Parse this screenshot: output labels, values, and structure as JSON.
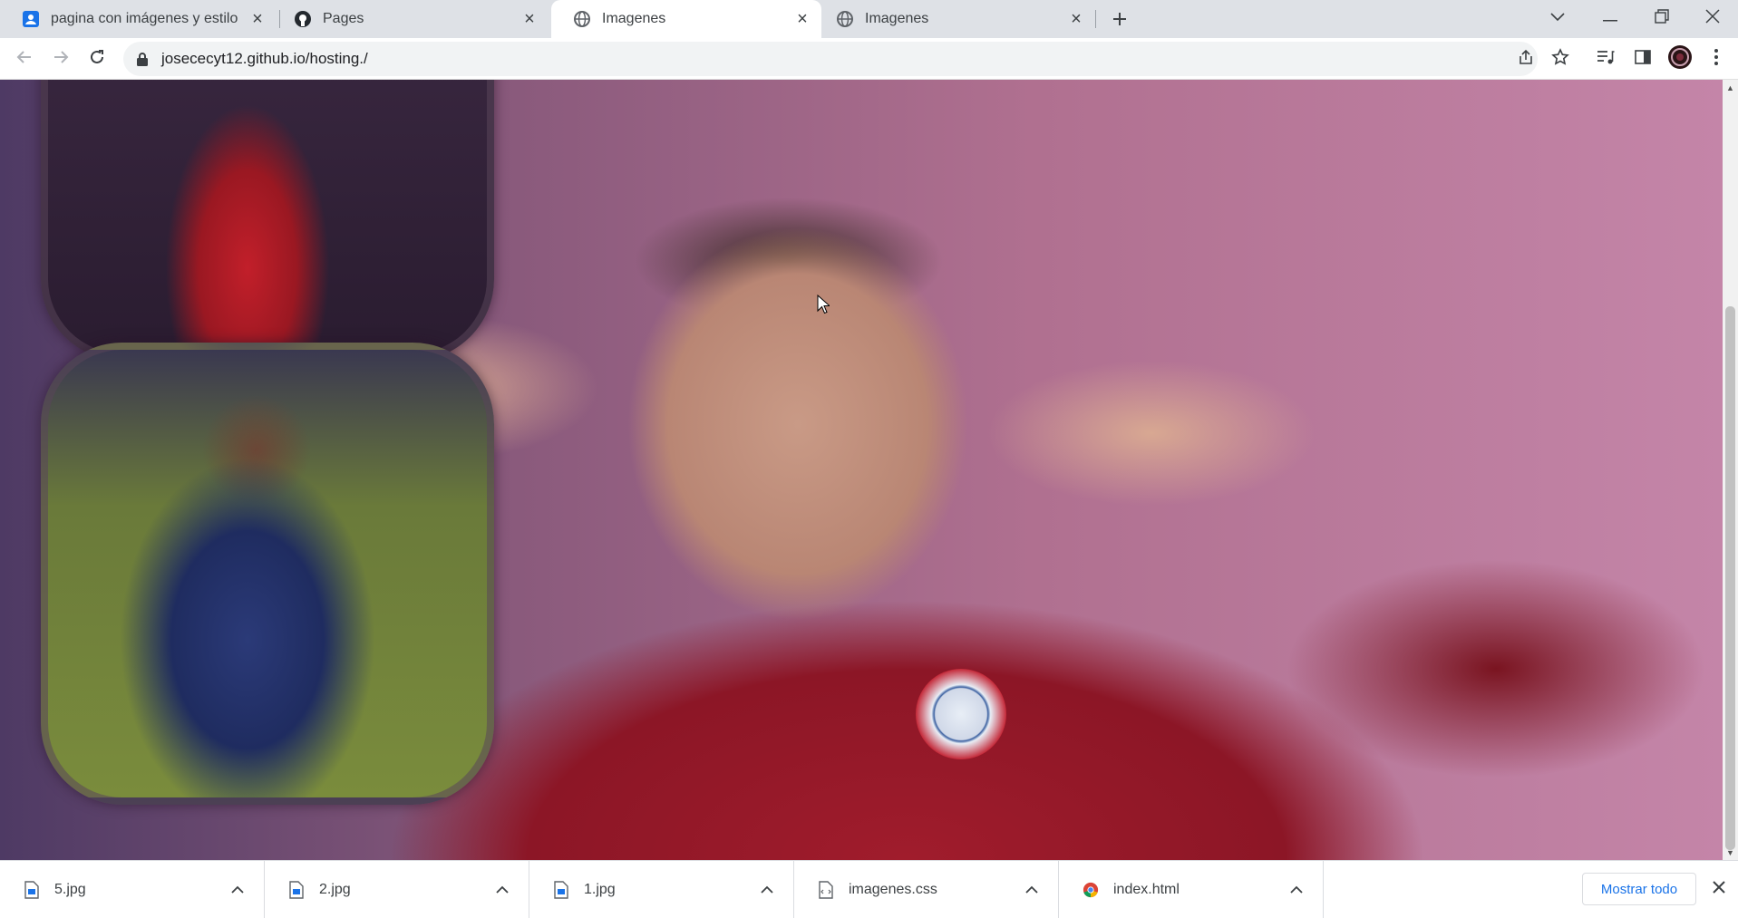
{
  "tabs": [
    {
      "title": "pagina con imágenes y estilo",
      "icon": "account-page-icon"
    },
    {
      "title": "Pages",
      "icon": "github-icon"
    },
    {
      "title": "Imagenes",
      "icon": "globe-icon"
    },
    {
      "title": "Imagenes",
      "icon": "globe-icon"
    }
  ],
  "address_bar": {
    "url": "josececyt12.github.io/hosting./"
  },
  "downloads": [
    {
      "name": "5.jpg",
      "icon": "image-file-icon"
    },
    {
      "name": "2.jpg",
      "icon": "image-file-icon"
    },
    {
      "name": "1.jpg",
      "icon": "image-file-icon"
    },
    {
      "name": "imagenes.css",
      "icon": "css-file-icon"
    },
    {
      "name": "index.html",
      "icon": "chrome-file-icon"
    }
  ],
  "downloads_bar": {
    "show_all_label": "Mostrar todo"
  },
  "colors": {
    "tab_strip": "#dee1e6",
    "link_blue": "#1a73e8",
    "jersey_red": "#a01c2c"
  }
}
